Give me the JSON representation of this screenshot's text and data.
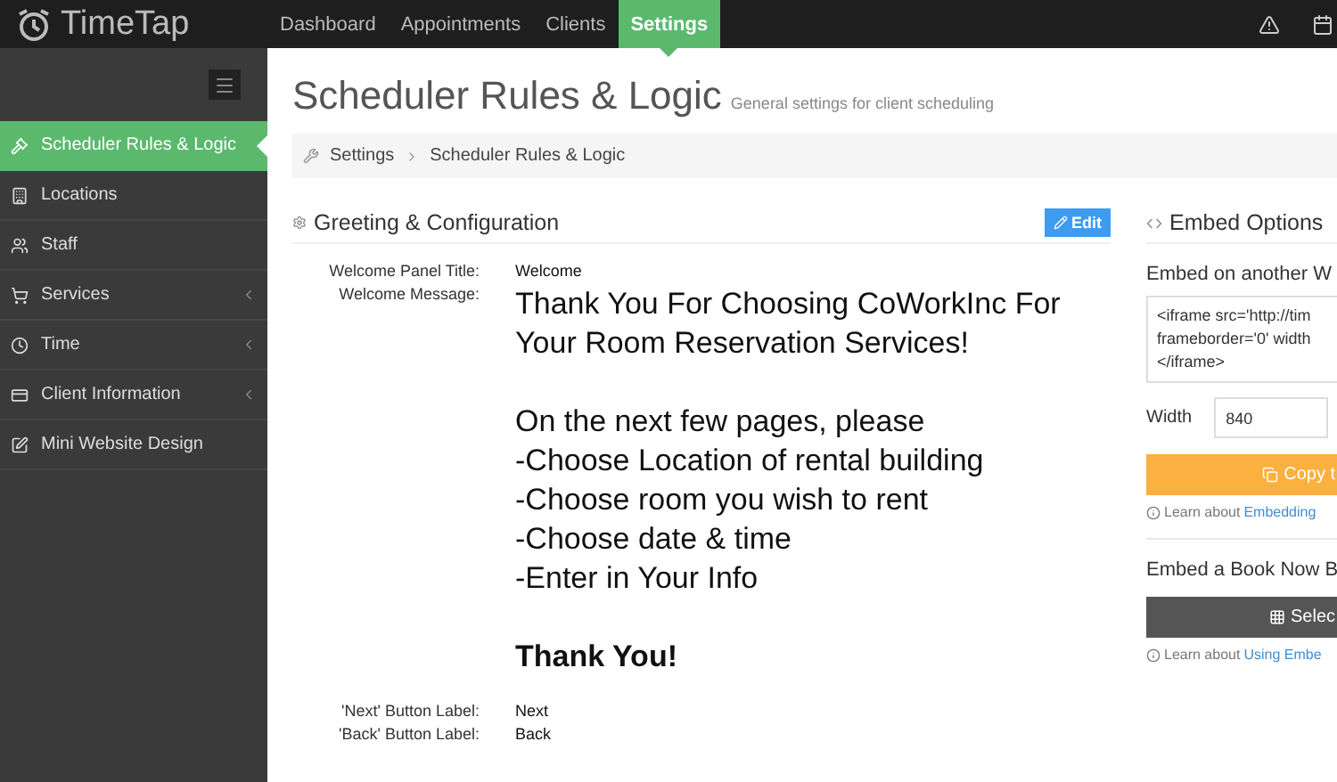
{
  "brand": "TimeTap",
  "nav": [
    {
      "label": "Dashboard",
      "selected": false
    },
    {
      "label": "Appointments",
      "selected": false
    },
    {
      "label": "Clients",
      "selected": false
    },
    {
      "label": "Settings",
      "selected": true
    }
  ],
  "sidebar": {
    "items": [
      {
        "label": "Scheduler Rules & Logic",
        "selected": true,
        "expandable": false
      },
      {
        "label": "Locations",
        "selected": false,
        "expandable": false
      },
      {
        "label": "Staff",
        "selected": false,
        "expandable": false
      },
      {
        "label": "Services",
        "selected": false,
        "expandable": true
      },
      {
        "label": "Time",
        "selected": false,
        "expandable": true
      },
      {
        "label": "Client Information",
        "selected": false,
        "expandable": true
      },
      {
        "label": "Mini Website Design",
        "selected": false,
        "expandable": false
      }
    ]
  },
  "page": {
    "title": "Scheduler Rules & Logic",
    "subtitle": "General settings for client scheduling"
  },
  "breadcrumb": [
    "Settings",
    "Scheduler Rules & Logic"
  ],
  "greeting": {
    "title": "Greeting & Configuration",
    "edit_button": "Edit",
    "fields": [
      {
        "label": "Welcome Panel Title:",
        "kind": "text",
        "value": "Welcome"
      },
      {
        "label": "Welcome Message:",
        "kind": "message",
        "paragraphs": [
          {
            "bold": false,
            "lines": [
              "Thank You For Choosing CoWorkInc For Your Room Reservation Services!"
            ]
          },
          {
            "bold": false,
            "lines": [
              "On the next few pages, please",
              "-Choose Location of rental building",
              "-Choose room you wish to rent",
              "-Choose date & time",
              "-Enter in Your Info"
            ]
          },
          {
            "bold": true,
            "lines": [
              "Thank You!"
            ]
          }
        ]
      },
      {
        "label": "'Next' Button Label:",
        "kind": "text",
        "value": "Next"
      },
      {
        "label": "'Back' Button Label:",
        "kind": "text",
        "value": "Back"
      }
    ]
  },
  "embed": {
    "title": "Embed Options",
    "subtitle": "Embed on another W",
    "code_lines": [
      "<iframe src='http://tim",
      "frameborder='0' width",
      "</iframe>"
    ],
    "width_label": "Width",
    "width_value": "840",
    "copy_button": "Copy t",
    "learn_1": {
      "text": "Learn about ",
      "link": "Embedding"
    },
    "book_title": "Embed a Book Now B",
    "select_button": "Selec",
    "learn_2": {
      "text": "Learn about ",
      "link": "Using Embe"
    }
  }
}
